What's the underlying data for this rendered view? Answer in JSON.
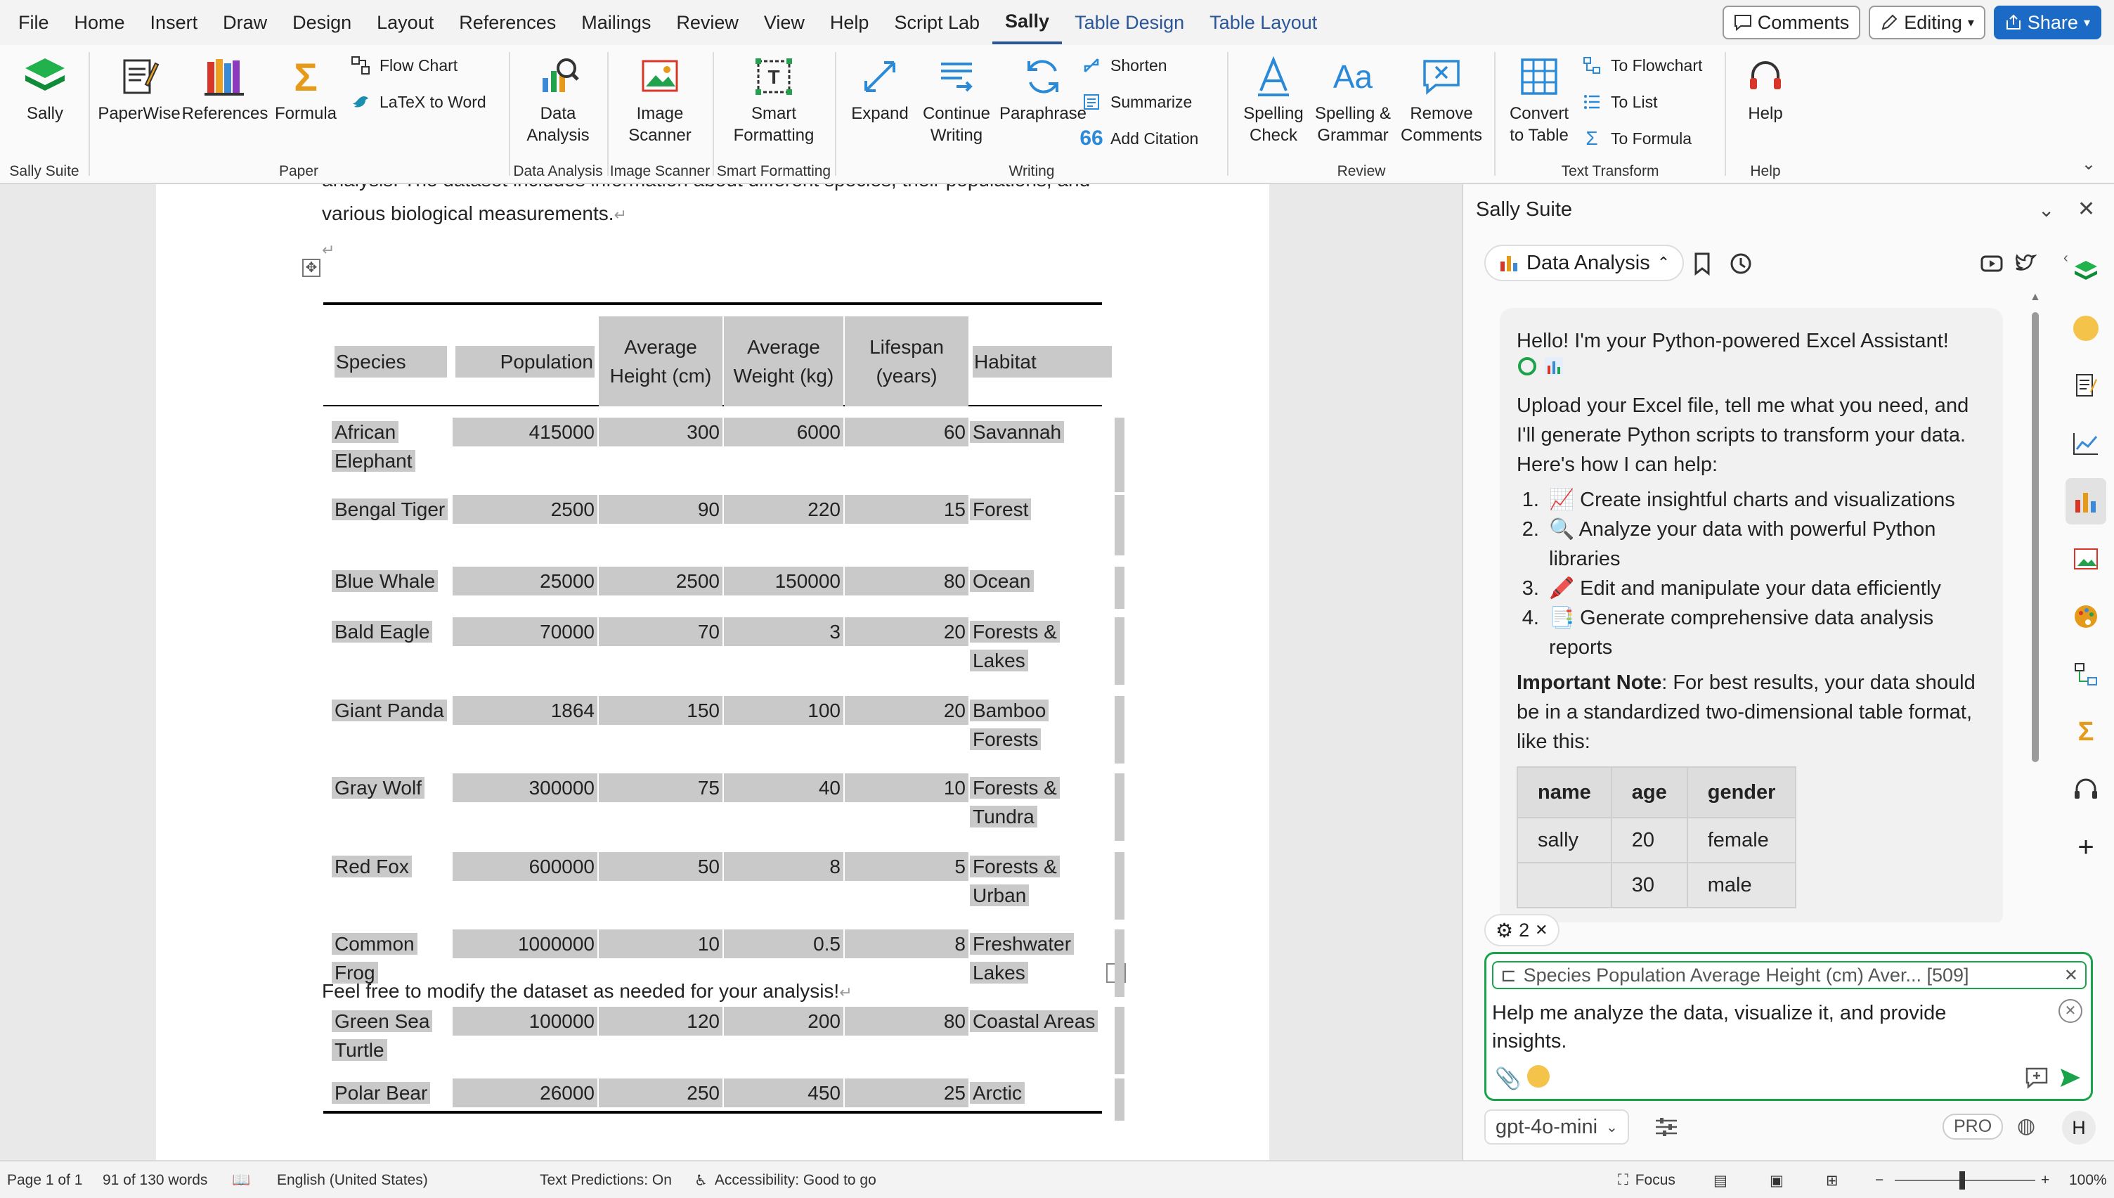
{
  "menubar": {
    "items": [
      "File",
      "Home",
      "Insert",
      "Draw",
      "Design",
      "Layout",
      "References",
      "Mailings",
      "Review",
      "View",
      "Help",
      "Script Lab",
      "Sally",
      "Table Design",
      "Table Layout"
    ],
    "comments": "Comments",
    "editing": "Editing",
    "share": "Share"
  },
  "ribbon": {
    "sally_suite": {
      "sally": "Sally",
      "group": "Sally Suite"
    },
    "paper": {
      "paperwise": "PaperWise",
      "references": "References",
      "formula": "Formula",
      "flow_chart": "Flow Chart",
      "latex_to_word": "LaTeX to Word",
      "group": "Paper"
    },
    "data_analysis": {
      "button_l1": "Data",
      "button_l2": "Analysis",
      "group": "Data Analysis"
    },
    "image_scanner": {
      "button_l1": "Image",
      "button_l2": "Scanner",
      "group": "Image Scanner"
    },
    "smart_formatting": {
      "button_l1": "Smart",
      "button_l2": "Formatting",
      "group": "Smart Formatting"
    },
    "writing": {
      "expand": "Expand",
      "continue_l1": "Continue",
      "continue_l2": "Writing",
      "paraphrase": "Paraphrase",
      "shorten": "Shorten",
      "summarize": "Summarize",
      "add_citation": "Add Citation",
      "group": "Writing"
    },
    "review": {
      "spelling_l1": "Spelling",
      "spelling_l2": "Check",
      "grammar_l1": "Spelling &",
      "grammar_l2": "Grammar",
      "remove_l1": "Remove",
      "remove_l2": "Comments",
      "group": "Review"
    },
    "text_transform": {
      "convert_l1": "Convert",
      "convert_l2": "to Table",
      "to_flowchart": "To Flowchart",
      "to_list": "To List",
      "to_formula": "To Formula",
      "group": "Text Transform"
    },
    "help": {
      "button": "Help",
      "group": "Help"
    }
  },
  "document": {
    "intro_line1": "analysis. The dataset includes information about different species, their populations, and",
    "intro_line2": "various biological measurements.",
    "footer_text": "Feel free to modify the dataset as needed for your analysis!",
    "table": {
      "headers": [
        "Species",
        "Population",
        "Average Height (cm)",
        "Average Weight (kg)",
        "Lifespan (years)",
        "Habitat"
      ],
      "rows": [
        [
          "African Elephant",
          "415000",
          "300",
          "6000",
          "60",
          "Savannah"
        ],
        [
          "Bengal Tiger",
          "2500",
          "90",
          "220",
          "15",
          "Forest"
        ],
        [
          "Blue Whale",
          "25000",
          "2500",
          "150000",
          "80",
          "Ocean"
        ],
        [
          "Bald Eagle",
          "70000",
          "70",
          "3",
          "20",
          "Forests & Lakes"
        ],
        [
          "Giant Panda",
          "1864",
          "150",
          "100",
          "20",
          "Bamboo Forests"
        ],
        [
          "Gray Wolf",
          "300000",
          "75",
          "40",
          "10",
          "Forests & Tundra"
        ],
        [
          "Red Fox",
          "600000",
          "50",
          "8",
          "5",
          "Forests & Urban"
        ],
        [
          "Common Frog",
          "1000000",
          "10",
          "0.5",
          "8",
          "Freshwater Lakes"
        ],
        [
          "Green Sea Turtle",
          "100000",
          "120",
          "200",
          "80",
          "Coastal Areas"
        ],
        [
          "Polar Bear",
          "26000",
          "250",
          "450",
          "25",
          "Arctic"
        ]
      ]
    }
  },
  "taskpane": {
    "title": "Sally Suite",
    "tab_label": "Data Analysis",
    "greeting": "Hello! I'm your Python-powered Excel Assistant!",
    "intro": "Upload your Excel file, tell me what you need, and I'll generate Python scripts to transform your data. Here's how I can help:",
    "list": [
      "📈 Create insightful charts and visualizations",
      "🔍 Analyze your data with powerful Python libraries",
      "🖍️ Edit and manipulate your data efficiently",
      "📑 Generate comprehensive data analysis reports"
    ],
    "note_bold": "Important Note",
    "note_rest": ": For best results, your data should be in a standardized two-dimensional table format, like this:",
    "sample_table": {
      "headers": [
        "name",
        "age",
        "gender"
      ],
      "rows": [
        [
          "sally",
          "20",
          "female"
        ],
        [
          "",
          "30",
          "male"
        ]
      ]
    },
    "settings_count": "2",
    "attachment": "Species Population Average Height (cm) Aver... [509]",
    "input_value": "Help me analyze the data, visualize it, and provide insights.",
    "model": "gpt-4o-mini",
    "pro": "PRO",
    "avatar": "H"
  },
  "status": {
    "page": "Page 1 of 1",
    "words": "91 of 130 words",
    "language": "English (United States)",
    "predictions": "Text Predictions: On",
    "accessibility": "Accessibility: Good to go",
    "focus": "Focus",
    "zoom": "100%"
  },
  "colors": {
    "accent": "#2b579a",
    "share": "#1b6ac6",
    "send": "#1aa34a",
    "cell_shade": "#c9c9c9"
  }
}
